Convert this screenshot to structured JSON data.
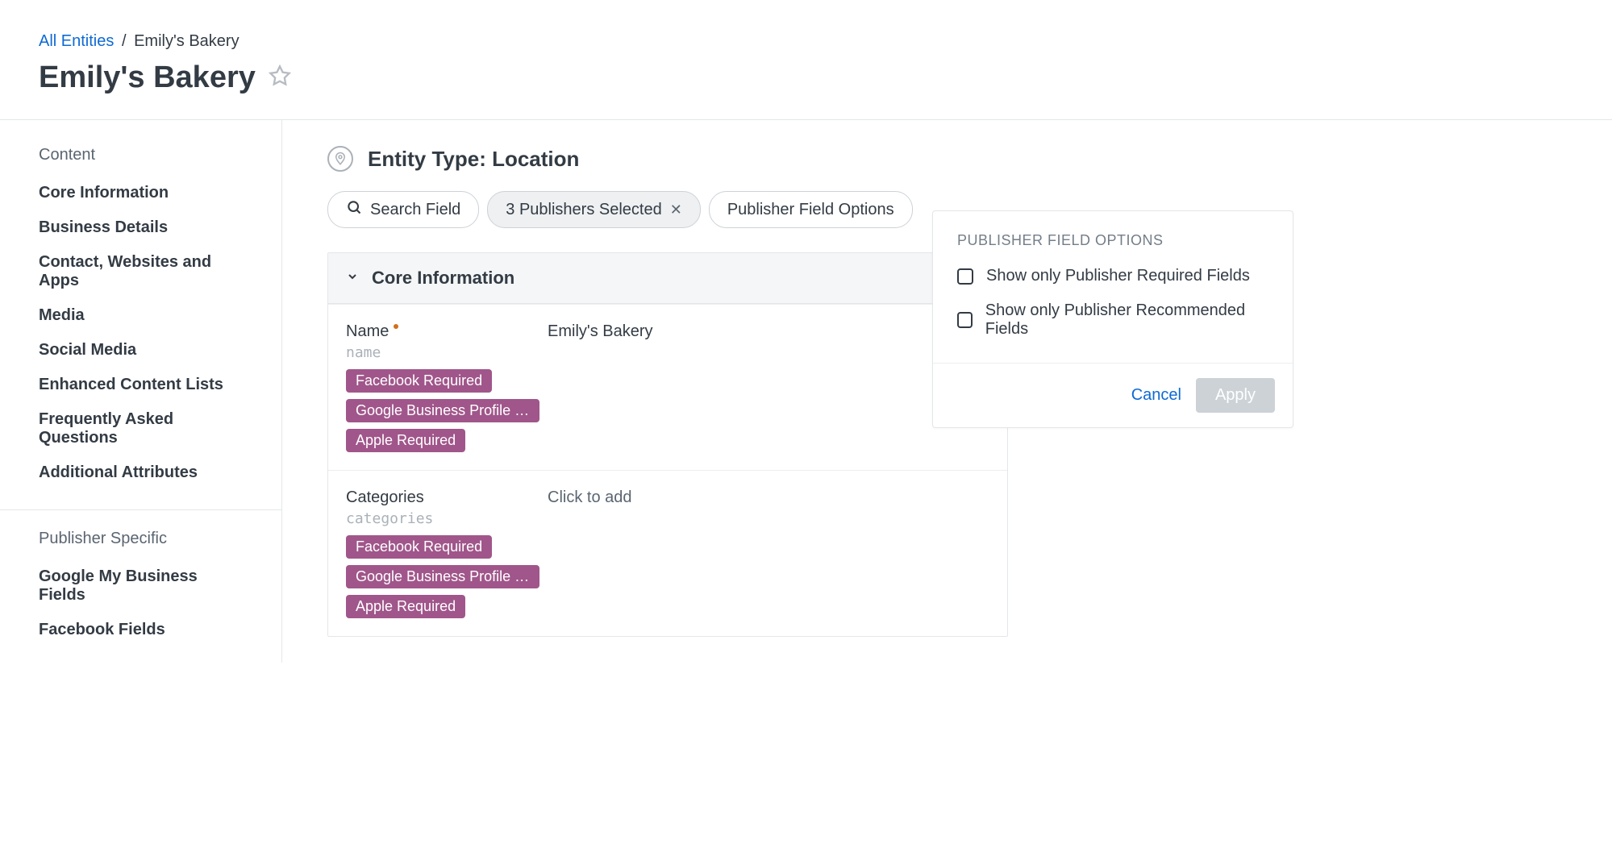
{
  "breadcrumb": {
    "root": "All Entities",
    "separator": "/",
    "current": "Emily's Bakery"
  },
  "page_title": "Emily's Bakery",
  "sidebar": {
    "content_label": "Content",
    "items": [
      "Core Information",
      "Business Details",
      "Contact, Websites and Apps",
      "Media",
      "Social Media",
      "Enhanced Content Lists",
      "Frequently Asked Questions",
      "Additional Attributes"
    ],
    "publisher_label": "Publisher Specific",
    "publisher_items": [
      "Google My Business Fields",
      "Facebook Fields"
    ]
  },
  "entity": {
    "type_label": "Entity Type: Location"
  },
  "filters": {
    "search_label": "Search Field",
    "publishers_label": "3 Publishers Selected",
    "options_label": "Publisher Field Options"
  },
  "section": {
    "title": "Core Information",
    "fields": [
      {
        "label": "Name",
        "code": "name",
        "value": "Emily's Bakery",
        "required_marker": true,
        "placeholder": false,
        "badges": [
          "Facebook Required",
          "Google Business Profile Req…",
          "Apple Required"
        ]
      },
      {
        "label": "Categories",
        "code": "categories",
        "value": "Click to add",
        "required_marker": false,
        "placeholder": true,
        "badges": [
          "Facebook Required",
          "Google Business Profile Req…",
          "Apple Required"
        ]
      }
    ]
  },
  "popover": {
    "title": "PUBLISHER FIELD OPTIONS",
    "option1": "Show only Publisher Required Fields",
    "option2": "Show only Publisher Recommended Fields",
    "cancel": "Cancel",
    "apply": "Apply"
  }
}
